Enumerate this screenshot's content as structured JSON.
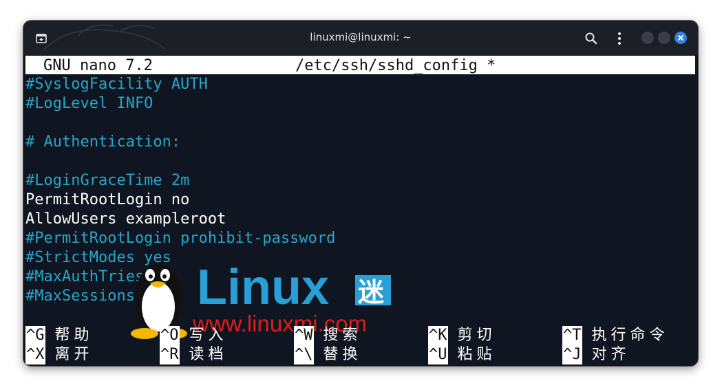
{
  "window": {
    "title": "linuxmi@linuxmi: ~",
    "icons": [
      "new-tab-icon",
      "search-icon",
      "menu-icon",
      "minimize-icon",
      "maximize-icon",
      "close-icon"
    ],
    "close_color": "#2f7fe5"
  },
  "nano": {
    "app": "GNU nano 7.2",
    "file": "/etc/ssh/sshd_config *"
  },
  "lines": [
    "#SyslogFacility AUTH",
    "#LogLevel INFO",
    "",
    "# Authentication:",
    "",
    "#LoginGraceTime 2m",
    "PermitRootLogin no",
    "AllowUsers exampleroot",
    "#PermitRootLogin prohibit-password",
    "#StrictModes yes",
    "#MaxAuthTries 6",
    "#MaxSessions 10"
  ],
  "watermark": {
    "brand": "Linux",
    "brand_cn": "迷",
    "url": "www.linuxmi.com"
  },
  "shortcuts": [
    {
      "key": "^G",
      "label": "帮助"
    },
    {
      "key": "^O",
      "label": "写入"
    },
    {
      "key": "^W",
      "label": "搜索"
    },
    {
      "key": "^K",
      "label": "剪切"
    },
    {
      "key": "^T",
      "label": "执行命令"
    },
    {
      "key": "^X",
      "label": "离开"
    },
    {
      "key": "^R",
      "label": "读档"
    },
    {
      "key": "^\\",
      "label": "替换"
    },
    {
      "key": "^U",
      "label": "粘贴"
    },
    {
      "key": "^J",
      "label": "对齐"
    }
  ],
  "colors": {
    "background": "#0f1621",
    "comment": "#2aa5c8",
    "text": "#ffffff"
  }
}
